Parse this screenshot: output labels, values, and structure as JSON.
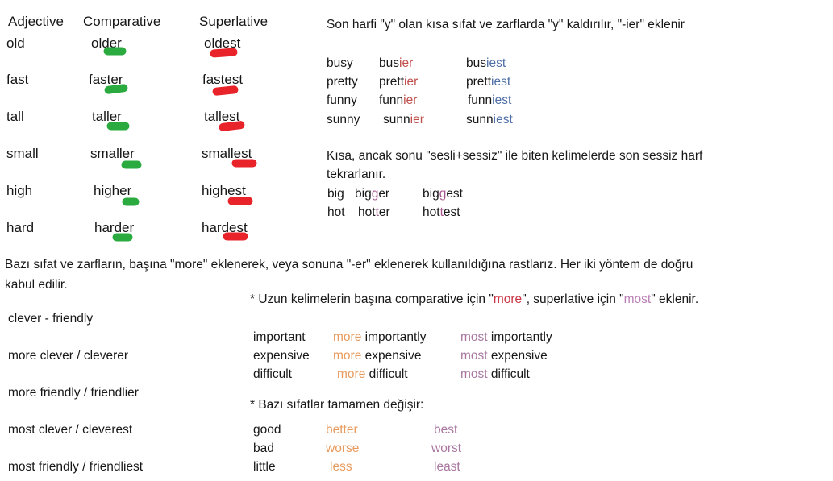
{
  "colors": {
    "green_mark": "#2aaa3f",
    "red_mark": "#e8232a",
    "suffix_ier": "#c0504d",
    "suffix_iest": "#4f6fa8",
    "doubled_consonant": "#a8568f",
    "more_orange": "#e89a5c",
    "most_purple": "#a876a0",
    "more_inline_red": "#cc3344",
    "most_inline_purple": "#bb7fb5",
    "text": "#171717"
  },
  "degree_table": {
    "headers": {
      "adjective": "Adjective",
      "comparative": "Comparative",
      "superlative": "Superlative"
    },
    "rows": [
      {
        "adjective": "old",
        "comparative": "older",
        "superlative": "oldest"
      },
      {
        "adjective": "fast",
        "comparative": "faster",
        "superlative": "fastest"
      },
      {
        "adjective": "tall",
        "comparative": "taller",
        "superlative": "tallest"
      },
      {
        "adjective": "small",
        "comparative": "smaller",
        "superlative": "smallest"
      },
      {
        "adjective": "high",
        "comparative": "higher",
        "superlative": "highest"
      },
      {
        "adjective": "hard",
        "comparative": "harder",
        "superlative": "hardest"
      }
    ]
  },
  "y_rule": {
    "heading": "Son harfi \"y\" olan kısa sıfat ve zarflarda \"y\" kaldırılır, \"-ier\" eklenir",
    "rows": [
      {
        "base": "busy",
        "comp_stem": "bus",
        "comp_sfx": "ier",
        "sup_stem": "bus",
        "sup_sfx": "iest"
      },
      {
        "base": "pretty",
        "comp_stem": "prett",
        "comp_sfx": "ier",
        "sup_stem": "prett",
        "sup_sfx": "iest"
      },
      {
        "base": "funny",
        "comp_stem": "funn",
        "comp_sfx": "ier",
        "sup_stem": "funn",
        "sup_sfx": "iest"
      },
      {
        "base": "sunny",
        "comp_stem": "sunn",
        "comp_sfx": "ier",
        "sup_stem": "sunn",
        "sup_sfx": "iest"
      }
    ]
  },
  "double_rule": {
    "heading_line1": "Kısa, ancak sonu \"sesli+sessiz\" ile biten kelimelerde son sessiz harf",
    "heading_line2": "tekrarlanır.",
    "rows": [
      {
        "base": "big",
        "comp_a": "big",
        "comp_dbl": "g",
        "comp_b": "er",
        "sup_a": "big",
        "sup_dbl": "g",
        "sup_b": "est"
      },
      {
        "base": "hot",
        "comp_a": "hot",
        "comp_dbl": "t",
        "comp_b": "er",
        "sup_a": "hot",
        "sup_dbl": "t",
        "sup_b": "est"
      }
    ]
  },
  "paragraph": {
    "line1": "Bazı sıfat ve zarfların, başına \"more\" eklenerek, veya sonuna \"-er\" eklenerek kullanıldığına rastlarız. Her iki yöntem de doğru",
    "line2": "kabul edilir."
  },
  "long_word_note": {
    "pre": "* Uzun kelimelerin başına comparative için \"",
    "more": "more",
    "mid": "\", superlative için \"",
    "most": "most",
    "post": "\" eklenir."
  },
  "two_forms_list": [
    "clever - friendly",
    "more clever / cleverer",
    "more friendly / friendlier",
    "most clever / cleverest",
    "most friendly / friendliest"
  ],
  "long_words": {
    "rows": [
      {
        "base": "important",
        "more": "more",
        "comp": "importantly",
        "most": "most",
        "sup": "importantly"
      },
      {
        "base": "expensive",
        "more": "more",
        "comp": "expensive",
        "most": "most",
        "sup": "expensive"
      },
      {
        "base": "difficult",
        "more": "more",
        "comp": "difficult",
        "most": "most",
        "sup": "difficult"
      }
    ]
  },
  "irregular": {
    "heading": "* Bazı sıfatlar tamamen değişir:",
    "rows": [
      {
        "base": "good",
        "comparative": "better",
        "superlative": "best"
      },
      {
        "base": "bad",
        "comparative": "worse",
        "superlative": "worst"
      },
      {
        "base": "little",
        "comparative": "less",
        "superlative": "least"
      }
    ]
  }
}
